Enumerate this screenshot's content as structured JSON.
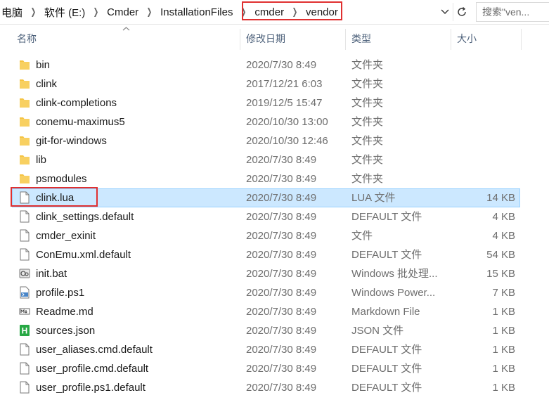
{
  "breadcrumb": [
    "电脑",
    "软件 (E:)",
    "Cmder",
    "InstallationFiles",
    "cmder",
    "vendor"
  ],
  "search": {
    "placeholder": "搜索\"ven..."
  },
  "columns": {
    "name": "名称",
    "date": "修改日期",
    "type": "类型",
    "size": "大小"
  },
  "files": [
    {
      "icon": "folder",
      "name": "bin",
      "date": "2020/7/30 8:49",
      "type": "文件夹",
      "size": ""
    },
    {
      "icon": "folder",
      "name": "clink",
      "date": "2017/12/21 6:03",
      "type": "文件夹",
      "size": ""
    },
    {
      "icon": "folder",
      "name": "clink-completions",
      "date": "2019/12/5 15:47",
      "type": "文件夹",
      "size": ""
    },
    {
      "icon": "folder",
      "name": "conemu-maximus5",
      "date": "2020/10/30 13:00",
      "type": "文件夹",
      "size": ""
    },
    {
      "icon": "folder",
      "name": "git-for-windows",
      "date": "2020/10/30 12:46",
      "type": "文件夹",
      "size": ""
    },
    {
      "icon": "folder",
      "name": "lib",
      "date": "2020/7/30 8:49",
      "type": "文件夹",
      "size": ""
    },
    {
      "icon": "folder",
      "name": "psmodules",
      "date": "2020/7/30 8:49",
      "type": "文件夹",
      "size": ""
    },
    {
      "icon": "file",
      "name": "clink.lua",
      "date": "2020/7/30 8:49",
      "type": "LUA 文件",
      "size": "14 KB",
      "selected": true
    },
    {
      "icon": "file",
      "name": "clink_settings.default",
      "date": "2020/7/30 8:49",
      "type": "DEFAULT 文件",
      "size": "4 KB"
    },
    {
      "icon": "file",
      "name": "cmder_exinit",
      "date": "2020/7/30 8:49",
      "type": "文件",
      "size": "4 KB"
    },
    {
      "icon": "file",
      "name": "ConEmu.xml.default",
      "date": "2020/7/30 8:49",
      "type": "DEFAULT 文件",
      "size": "54 KB"
    },
    {
      "icon": "bat",
      "name": "init.bat",
      "date": "2020/7/30 8:49",
      "type": "Windows 批处理...",
      "size": "15 KB"
    },
    {
      "icon": "ps1",
      "name": "profile.ps1",
      "date": "2020/7/30 8:49",
      "type": "Windows Power...",
      "size": "7 KB"
    },
    {
      "icon": "md",
      "name": "Readme.md",
      "date": "2020/7/30 8:49",
      "type": "Markdown File",
      "size": "1 KB"
    },
    {
      "icon": "json",
      "name": "sources.json",
      "date": "2020/7/30 8:49",
      "type": "JSON 文件",
      "size": "1 KB"
    },
    {
      "icon": "file",
      "name": "user_aliases.cmd.default",
      "date": "2020/7/30 8:49",
      "type": "DEFAULT 文件",
      "size": "1 KB"
    },
    {
      "icon": "file",
      "name": "user_profile.cmd.default",
      "date": "2020/7/30 8:49",
      "type": "DEFAULT 文件",
      "size": "1 KB"
    },
    {
      "icon": "file",
      "name": "user_profile.ps1.default",
      "date": "2020/7/30 8:49",
      "type": "DEFAULT 文件",
      "size": "1 KB"
    }
  ],
  "colors": {
    "folder": "#f5c342",
    "selected_bg": "#cce8ff",
    "highlight": "#e03030",
    "json_badge": "#27a844"
  }
}
